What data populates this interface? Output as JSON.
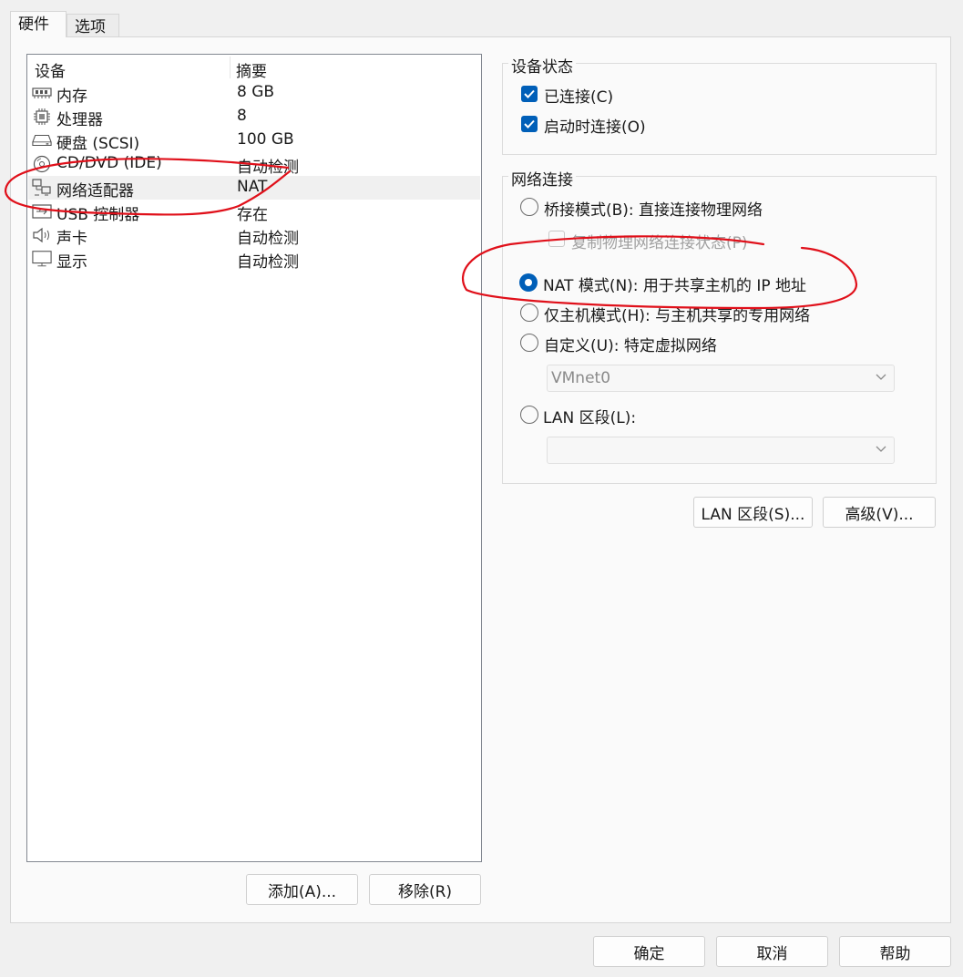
{
  "tabs": [
    {
      "label": "硬件"
    },
    {
      "label": "选项"
    }
  ],
  "device_list": {
    "columns": [
      "设备",
      "摘要"
    ],
    "rows": [
      {
        "name": "内存",
        "summary": "8 GB",
        "icon": "memory-icon"
      },
      {
        "name": "处理器",
        "summary": "8",
        "icon": "processor-icon"
      },
      {
        "name": "硬盘 (SCSI)",
        "summary": "100 GB",
        "icon": "hard-disk-icon"
      },
      {
        "name": "CD/DVD (IDE)",
        "summary": "自动检测",
        "icon": "cd-dvd-icon"
      },
      {
        "name": "网络适配器",
        "summary": "NAT",
        "icon": "network-adapter-icon",
        "selected": true
      },
      {
        "name": "USB 控制器",
        "summary": "存在",
        "icon": "usb-icon"
      },
      {
        "name": "声卡",
        "summary": "自动检测",
        "icon": "speaker-icon"
      },
      {
        "name": "显示",
        "summary": "自动检测",
        "icon": "monitor-icon"
      }
    ],
    "add_button": "添加(A)...",
    "remove_button": "移除(R)"
  },
  "device_status": {
    "title": "设备状态",
    "connected": {
      "label": "已连接(C)",
      "checked": true
    },
    "connect_at_power_on": {
      "label": "启动时连接(O)",
      "checked": true
    }
  },
  "network_connection": {
    "title": "网络连接",
    "bridged": {
      "label": "桥接模式(B): 直接连接物理网络",
      "selected": false
    },
    "replicate_state": {
      "label": "复制物理网络连接状态(P)",
      "checked": false,
      "disabled": true
    },
    "nat": {
      "label": "NAT 模式(N): 用于共享主机的 IP 地址",
      "selected": true
    },
    "host_only": {
      "label": "仅主机模式(H): 与主机共享的专用网络",
      "selected": false
    },
    "custom": {
      "label": "自定义(U): 特定虚拟网络",
      "selected": false
    },
    "custom_select": {
      "value": "VMnet0"
    },
    "lan_segment": {
      "label": "LAN 区段(L):",
      "selected": false
    },
    "lan_select": {
      "value": ""
    }
  },
  "buttons": {
    "lan_segments": "LAN 区段(S)...",
    "advanced": "高级(V)...",
    "ok": "确定",
    "cancel": "取消",
    "help": "帮助"
  },
  "colors": {
    "accent": "#005fb8",
    "annotation": "#e0101a"
  }
}
